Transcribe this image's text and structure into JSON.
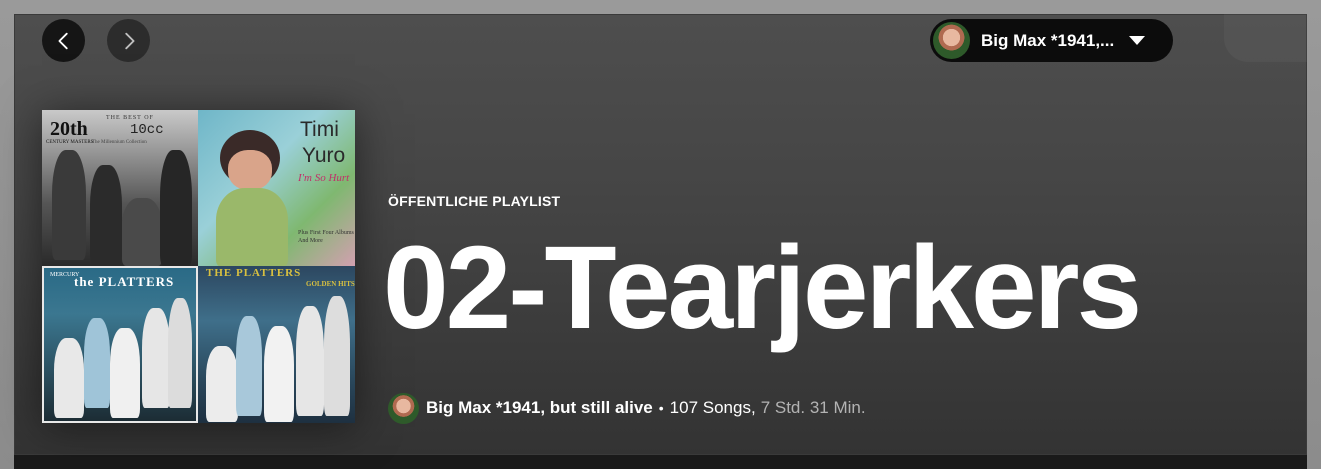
{
  "nav": {
    "back_icon": "chevron-left-icon",
    "forward_icon": "chevron-right-icon"
  },
  "user_menu": {
    "name": "Big Max *1941,...",
    "caret_icon": "caret-down-icon"
  },
  "cover_text": {
    "tile1_small": "THE BEST OF",
    "tile1_big": "10cc",
    "tile1_sub": "The Millennium Collection",
    "tile1_20": "20th",
    "tile1_century": "CENTURY MASTERS",
    "tile2_line1": "Timi",
    "tile2_line2": "Yuro",
    "tile2_subtitle": "I'm So Hurt",
    "tile2_note1": "Plus First Four Albums",
    "tile2_note2": "And More",
    "tile3_small": "MERCURY",
    "tile3_big": "the PLATTERS",
    "tile4_big": "THE PLATTERS",
    "tile4_sub": "GOLDEN HITS"
  },
  "header": {
    "eyebrow": "ÖFFENTLICHE PLAYLIST",
    "title": "02-Tearjerkers"
  },
  "meta": {
    "owner": "Big Max *1941, but still alive",
    "separator": "•",
    "song_count": "107 Songs,",
    "duration": "7 Std. 31 Min."
  },
  "colors": {
    "background_top": "#4e4e4e",
    "background_bottom": "#333333",
    "text_primary": "#ffffff",
    "text_secondary": "#b3b3b3"
  }
}
